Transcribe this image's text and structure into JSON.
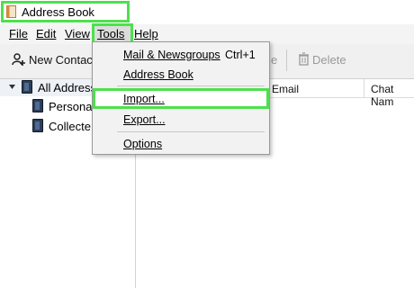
{
  "window": {
    "title": "Address Book"
  },
  "menubar": {
    "items": [
      {
        "label": "File",
        "underline": "F"
      },
      {
        "label": "Edit",
        "underline": "E"
      },
      {
        "label": "View",
        "underline": "V"
      },
      {
        "label": "Tools",
        "underline": "T"
      },
      {
        "label": "Help",
        "underline": "H"
      }
    ]
  },
  "toolbar": {
    "new_contact": "New Contact",
    "delete": "Delete",
    "partial_label": "e"
  },
  "columns": {
    "email": "Email",
    "chat": "Chat Nam"
  },
  "tree": {
    "root": "All Address",
    "children": [
      "Personal...",
      "Collecte..."
    ]
  },
  "tools_menu": {
    "mail": "Mail & Newsgroups",
    "mail_shortcut": "Ctrl+1",
    "address_book": "Address Book",
    "import": "Import...",
    "export": "Export...",
    "options": "Options"
  },
  "colors": {
    "highlight": "#4ee04e",
    "book_icon": "#2c3e57"
  }
}
